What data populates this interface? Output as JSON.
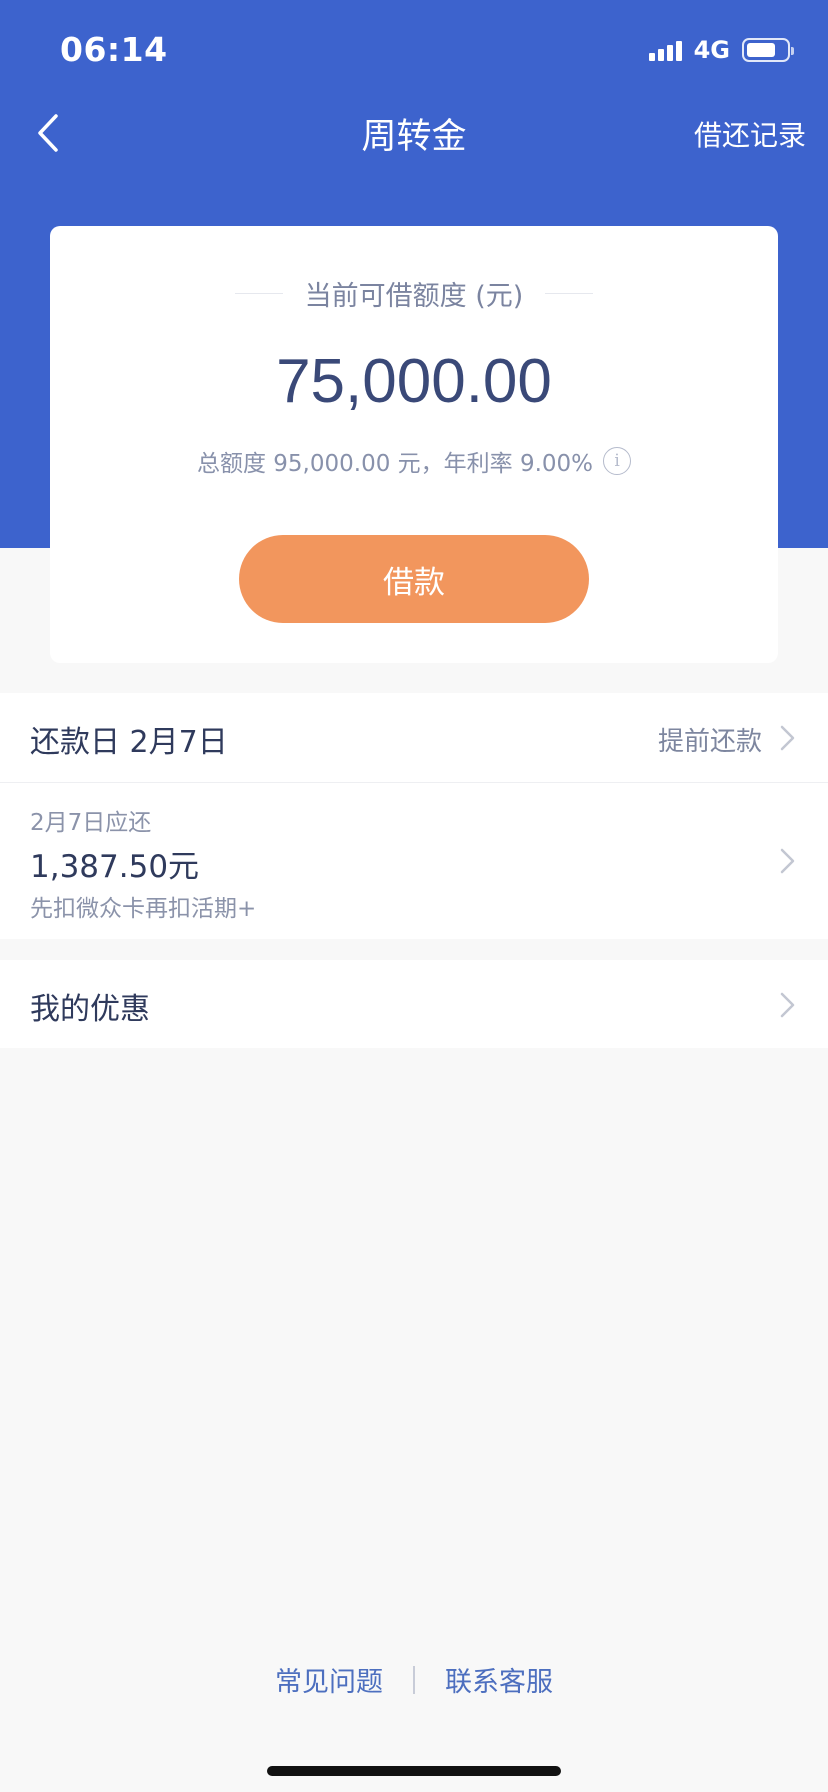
{
  "status_bar": {
    "time": "06:14",
    "network": "4G"
  },
  "nav": {
    "title": "周转金",
    "action": "借还记录"
  },
  "card": {
    "label": "当前可借额度 (元)",
    "amount": "75,000.00",
    "quota_text": "总额度 95,000.00 元，年利率 9.00%",
    "borrow_label": "借款"
  },
  "repayment": {
    "title": "还款日 2月7日",
    "early_label": "提前还款",
    "due_date": "2月7日应还",
    "due_amount": "1,387.50元",
    "note": "先扣微众卡再扣活期+"
  },
  "offers": {
    "title": "我的优惠"
  },
  "footer": {
    "faq": "常见问题",
    "service": "联系客服"
  },
  "colors": {
    "brand": "#3d63cd",
    "borrow_button": "#f2965d",
    "link": "#4d6fbf"
  }
}
